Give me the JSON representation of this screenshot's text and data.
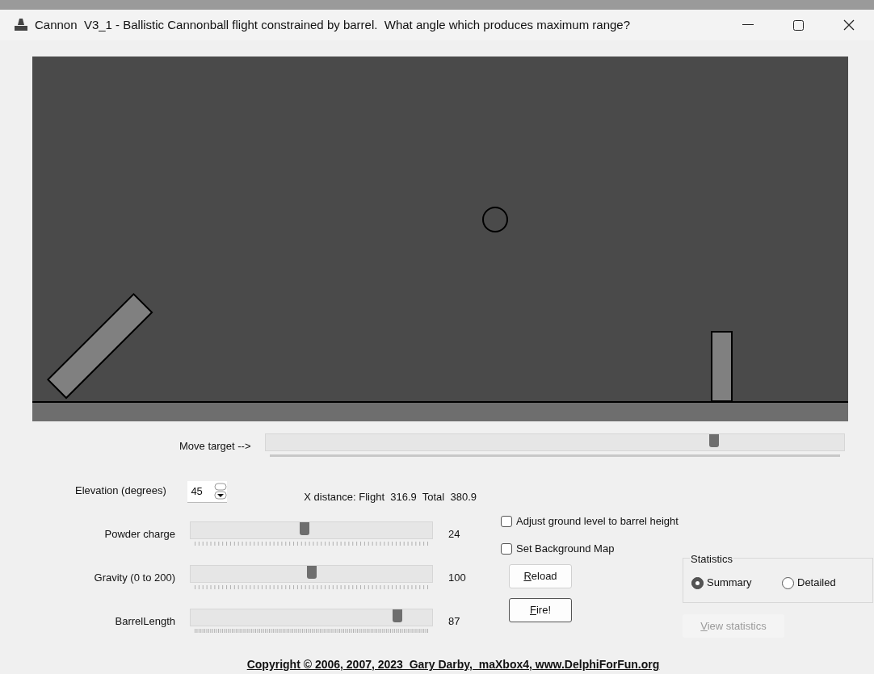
{
  "window": {
    "title": "Cannon  V3_1 - Ballistic Cannonball flight constrained by barrel.  What angle which produces maximum range?"
  },
  "move_target": {
    "label": "Move target -->",
    "level": 0.775
  },
  "elevation": {
    "label": "Elevation (degrees)",
    "value": "45"
  },
  "x_distance": "X distance: Flight  316.9  Total  380.9",
  "sliders": [
    {
      "label": "Powder charge",
      "level": 0.47,
      "value": "24",
      "kind": "coarse"
    },
    {
      "label": "Gravity (0 to 200)",
      "level": 0.5,
      "value": "100",
      "kind": "coarse"
    },
    {
      "label": "BarrelLength",
      "level": 0.857,
      "value": "87",
      "kind": "fine"
    }
  ],
  "checkboxes": [
    {
      "label": "Adjust ground level to barrel height",
      "checked": false
    },
    {
      "label": "Set Background Map",
      "checked": false
    }
  ],
  "buttons": [
    {
      "label": "Reload",
      "focused": false
    },
    {
      "label": "Fire!",
      "focused": true
    }
  ],
  "statistics": {
    "title": "Statistics",
    "options": [
      {
        "label": "Summary",
        "selected": true
      },
      {
        "label": "Detailed",
        "selected": false
      }
    ],
    "button": {
      "label": "View statistics",
      "disabled": true
    }
  },
  "copyright": "Copyright © 2006, 2007, 2023  Gary Darby,  maXbox4, www.DelphiForFun.org"
}
